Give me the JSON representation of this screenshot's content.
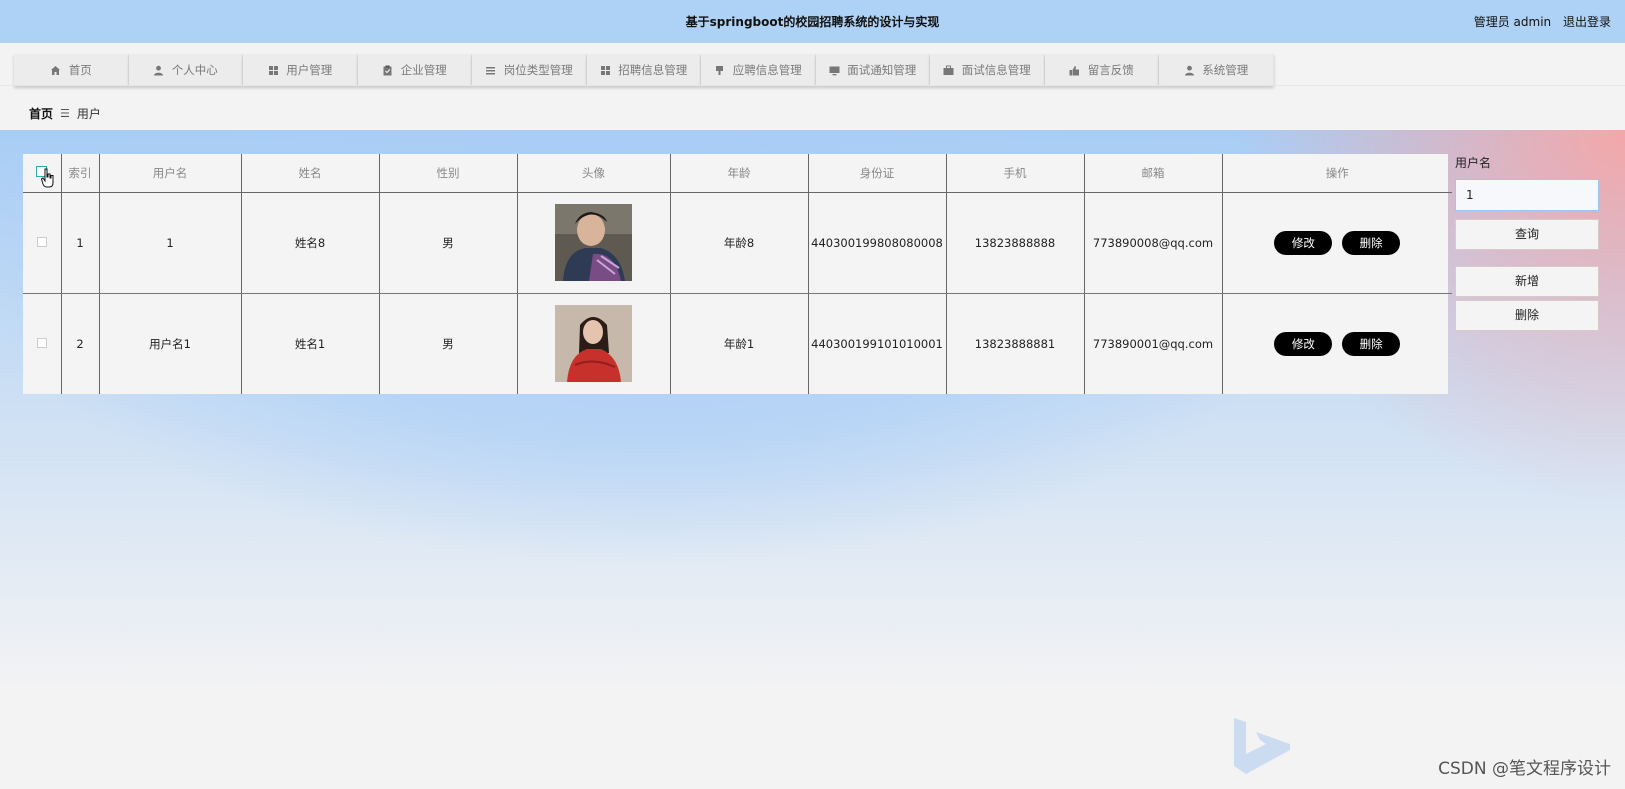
{
  "header": {
    "title": "基于springboot的校园招聘系统的设计与实现",
    "user_label": "管理员 admin",
    "logout_label": "退出登录"
  },
  "nav": {
    "items": [
      {
        "label": "首页",
        "icon": "home-icon"
      },
      {
        "label": "个人中心",
        "icon": "person-icon"
      },
      {
        "label": "用户管理",
        "icon": "grid-icon"
      },
      {
        "label": "企业管理",
        "icon": "clipboard-icon"
      },
      {
        "label": "岗位类型管理",
        "icon": "list-icon"
      },
      {
        "label": "招聘信息管理",
        "icon": "grid-icon"
      },
      {
        "label": "应聘信息管理",
        "icon": "pin-icon"
      },
      {
        "label": "面试通知管理",
        "icon": "monitor-icon"
      },
      {
        "label": "面试信息管理",
        "icon": "briefcase-icon"
      },
      {
        "label": "留言反馈",
        "icon": "thumbs-up-icon"
      },
      {
        "label": "系统管理",
        "icon": "person-icon"
      }
    ]
  },
  "breadcrumb": {
    "home": "首页",
    "separator": "☰",
    "current": "用户"
  },
  "table": {
    "columns": [
      "",
      "索引",
      "用户名",
      "姓名",
      "性别",
      "头像",
      "年龄",
      "身份证",
      "手机",
      "邮箱",
      "操作"
    ],
    "rows": [
      {
        "index": "1",
        "username": "1",
        "name": "姓名8",
        "gender": "男",
        "avatar": "male-avatar",
        "age": "年龄8",
        "id_card": "440300199808080008",
        "phone": "13823888888",
        "email": "773890008@qq.com"
      },
      {
        "index": "2",
        "username": "用户名1",
        "name": "姓名1",
        "gender": "男",
        "avatar": "female-avatar",
        "age": "年龄1",
        "id_card": "440300199101010001",
        "phone": "13823888881",
        "email": "773890001@qq.com"
      }
    ],
    "edit_label": "修改",
    "delete_label": "删除"
  },
  "side": {
    "search_label": "用户名",
    "search_value": "1",
    "query_label": "查询",
    "add_label": "新增",
    "delete_label": "删除"
  },
  "watermark": "CSDN @笔文程序设计",
  "colors": {
    "header_bg": "#aed2f6",
    "accent_blue": "#a9cdf6",
    "accent_pink": "#f4a7a9",
    "button_black": "#000000"
  }
}
